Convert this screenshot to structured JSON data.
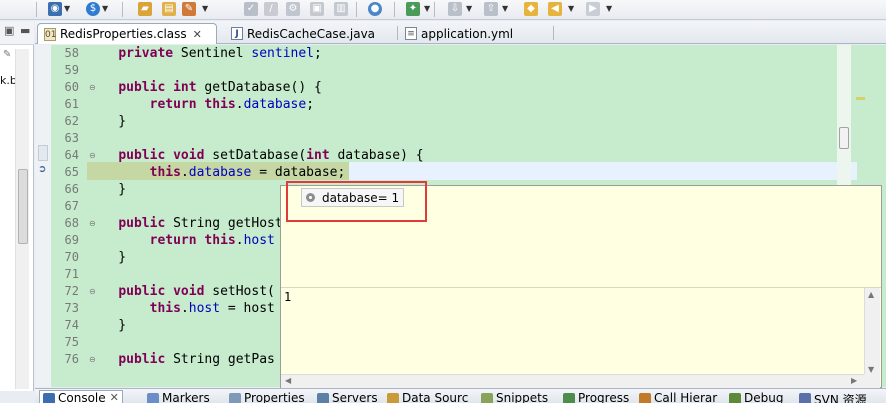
{
  "toolbar": {
    "icons": [
      "debug-icon",
      "run-icon",
      "open-icon",
      "build-icon",
      "search-icon",
      "globe-icon",
      "navigate-icon",
      "back-icon",
      "forward-icon"
    ]
  },
  "left_panel": {
    "label": "k.b"
  },
  "tabs": [
    {
      "label": "RedisProperties.class",
      "icon": "class-file-icon",
      "active": true
    },
    {
      "label": "RedisCacheCase.java",
      "icon": "java-file-icon",
      "active": false
    },
    {
      "label": "application.yml",
      "icon": "text-file-icon",
      "active": false
    }
  ],
  "editor": {
    "lines": [
      {
        "num": "58",
        "tokens": [
          {
            "t": "    "
          },
          {
            "t": "private",
            "c": "kw"
          },
          {
            "t": " Sentinel "
          },
          {
            "t": "sentinel",
            "c": "fld"
          },
          {
            "t": ";"
          }
        ]
      },
      {
        "num": "59",
        "tokens": []
      },
      {
        "num": "60",
        "fold": true,
        "tokens": [
          {
            "t": "    "
          },
          {
            "t": "public",
            "c": "kw"
          },
          {
            "t": " "
          },
          {
            "t": "int",
            "c": "kw"
          },
          {
            "t": " getDatabase() {"
          }
        ]
      },
      {
        "num": "61",
        "tokens": [
          {
            "t": "        "
          },
          {
            "t": "return",
            "c": "kw"
          },
          {
            "t": " "
          },
          {
            "t": "this",
            "c": "kw"
          },
          {
            "t": "."
          },
          {
            "t": "database",
            "c": "fld"
          },
          {
            "t": ";"
          }
        ]
      },
      {
        "num": "62",
        "tokens": [
          {
            "t": "    }"
          }
        ]
      },
      {
        "num": "63",
        "tokens": []
      },
      {
        "num": "64",
        "fold": true,
        "tokens": [
          {
            "t": "    "
          },
          {
            "t": "public",
            "c": "kw"
          },
          {
            "t": " "
          },
          {
            "t": "void",
            "c": "kw"
          },
          {
            "t": " setDatabase("
          },
          {
            "t": "int",
            "c": "kw"
          },
          {
            "t": " database) {"
          }
        ]
      },
      {
        "num": "65",
        "tokens": [
          {
            "t": "        "
          },
          {
            "t": "this",
            "c": "kw"
          },
          {
            "t": "."
          },
          {
            "t": "database",
            "c": "fld"
          },
          {
            "t": " = database;"
          }
        ]
      },
      {
        "num": "66",
        "tokens": [
          {
            "t": "    }"
          }
        ]
      },
      {
        "num": "67",
        "tokens": []
      },
      {
        "num": "68",
        "fold": true,
        "tokens": [
          {
            "t": "    "
          },
          {
            "t": "public",
            "c": "kw"
          },
          {
            "t": " String getHost"
          }
        ]
      },
      {
        "num": "69",
        "tokens": [
          {
            "t": "        "
          },
          {
            "t": "return",
            "c": "kw"
          },
          {
            "t": " "
          },
          {
            "t": "this",
            "c": "kw"
          },
          {
            "t": "."
          },
          {
            "t": "host",
            "c": "fld"
          }
        ]
      },
      {
        "num": "70",
        "tokens": [
          {
            "t": "    }"
          }
        ]
      },
      {
        "num": "71",
        "tokens": []
      },
      {
        "num": "72",
        "fold": true,
        "tokens": [
          {
            "t": "    "
          },
          {
            "t": "public",
            "c": "kw"
          },
          {
            "t": " "
          },
          {
            "t": "void",
            "c": "kw"
          },
          {
            "t": " setHost("
          }
        ]
      },
      {
        "num": "73",
        "tokens": [
          {
            "t": "        "
          },
          {
            "t": "this",
            "c": "kw"
          },
          {
            "t": "."
          },
          {
            "t": "host",
            "c": "fld"
          },
          {
            "t": " = host"
          }
        ]
      },
      {
        "num": "74",
        "tokens": [
          {
            "t": "    }"
          }
        ]
      },
      {
        "num": "75",
        "tokens": []
      },
      {
        "num": "76",
        "fold": true,
        "tokens": [
          {
            "t": "    "
          },
          {
            "t": "public",
            "c": "kw"
          },
          {
            "t": " String getPas"
          }
        ]
      }
    ]
  },
  "popup": {
    "variable_label": "database= 1",
    "variable_icon": "variable-icon",
    "value_text": "1"
  },
  "bottom_tabs": [
    {
      "label": "Console",
      "active": true,
      "icon": "console-icon",
      "color": "#3c6db1"
    },
    {
      "label": "Markers",
      "active": false,
      "icon": "markers-icon",
      "color": "#6a8fc8"
    },
    {
      "label": "Properties",
      "active": false,
      "icon": "properties-icon",
      "color": "#7f99b8"
    },
    {
      "label": "Servers",
      "active": false,
      "icon": "servers-icon",
      "color": "#5b7fa6"
    },
    {
      "label": "Data Sourc",
      "active": false,
      "icon": "data-source-icon",
      "color": "#c89a3a"
    },
    {
      "label": "Snippets",
      "active": false,
      "icon": "snippets-icon",
      "color": "#8aa35a"
    },
    {
      "label": "Progress",
      "active": false,
      "icon": "progress-icon",
      "color": "#4c8c4c"
    },
    {
      "label": "Call Hierar",
      "active": false,
      "icon": "call-hierarchy-icon",
      "color": "#c07a2a"
    },
    {
      "label": "Debug",
      "active": false,
      "icon": "debug-view-icon",
      "color": "#5a8a3a"
    },
    {
      "label": "SVN 资源",
      "active": false,
      "icon": "svn-icon",
      "color": "#5b6fa8"
    }
  ],
  "colors": {
    "editor_bg": "#c7ebcd",
    "keyword": "#7f0055",
    "field": "#0000c0",
    "popup_bg": "#ffffe1",
    "highlight": "#e03a3a"
  }
}
